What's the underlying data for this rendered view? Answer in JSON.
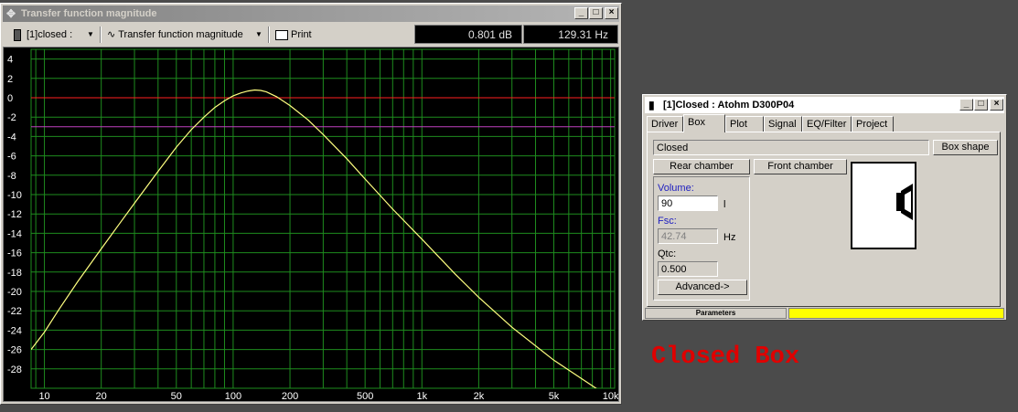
{
  "main_window": {
    "title": "Transfer function magnitude",
    "toolbar": {
      "config_label": "[1]closed :",
      "curve_label": "Transfer function magnitude",
      "print_label": "Print",
      "readout_db": "0.801 dB",
      "readout_hz": "129.31 Hz"
    }
  },
  "chart_data": {
    "type": "line",
    "x_scale": "log",
    "xlim": [
      8.5,
      10500
    ],
    "ylim": [
      -30,
      5
    ],
    "y_ticks": [
      "4",
      "2",
      "0",
      "-2",
      "-4",
      "-6",
      "-8",
      "-10",
      "-12",
      "-14",
      "-16",
      "-18",
      "-20",
      "-22",
      "-24",
      "-26",
      "-28"
    ],
    "y_tick_values": [
      4,
      2,
      0,
      -2,
      -4,
      -6,
      -8,
      -10,
      -12,
      -14,
      -16,
      -18,
      -20,
      -22,
      -24,
      -26,
      -28
    ],
    "x_ticks": [
      "10",
      "20",
      "50",
      "100",
      "200",
      "500",
      "1k",
      "2k",
      "5k",
      "10k"
    ],
    "x_tick_values": [
      10,
      20,
      50,
      100,
      200,
      500,
      1000,
      2000,
      5000,
      10000
    ],
    "grid": true,
    "reference_lines": [
      {
        "y": 0,
        "color": "#ff2020"
      },
      {
        "y": -3,
        "color": "#c040c0"
      }
    ],
    "series": [
      {
        "color": "#ffff80",
        "x": [
          8.5,
          10,
          12,
          15,
          20,
          25,
          30,
          40,
          50,
          60,
          70,
          80,
          90,
          100,
          110,
          120,
          130,
          140,
          150,
          170,
          200,
          250,
          300,
          400,
          500,
          700,
          1000,
          1500,
          2000,
          3000,
          5000,
          7000,
          10000
        ],
        "y": [
          -26,
          -24.2,
          -21.8,
          -19,
          -15.6,
          -13,
          -10.9,
          -7.6,
          -5.1,
          -3.3,
          -2,
          -1,
          -0.3,
          0.2,
          0.5,
          0.7,
          0.8,
          0.75,
          0.6,
          0.1,
          -0.8,
          -2.3,
          -3.8,
          -6.3,
          -8.4,
          -11.5,
          -14.6,
          -18.2,
          -20.6,
          -23.7,
          -27.1,
          -29,
          -31
        ]
      }
    ]
  },
  "box_window": {
    "title": "[1]Closed : Atohm D300P04",
    "tabs": [
      "Driver",
      "Box",
      "Plot",
      "Signal",
      "EQ/Filter",
      "Project"
    ],
    "active_tab": "Box",
    "box_type": "Closed",
    "box_shape_label": "Box shape",
    "rear_chamber_label": "Rear chamber",
    "front_chamber_label": "Front chamber",
    "volume_label": "Volume:",
    "volume_value": "90",
    "volume_unit": "l",
    "fsc_label": "Fsc:",
    "fsc_value": "42.74",
    "fsc_unit": "Hz",
    "qtc_label": "Qtc:",
    "qtc_value": "0.500",
    "advanced_label": "Advanced->",
    "status_label": "Parameters",
    "status_color": "#ffff00"
  },
  "overlay_caption": {
    "text": "Closed Box",
    "color": "#e00000"
  }
}
